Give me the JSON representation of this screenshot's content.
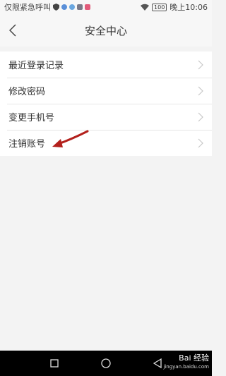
{
  "status_bar": {
    "carrier": "仅限紧急呼叫",
    "battery": "100",
    "time": "晚上10:06"
  },
  "header": {
    "title": "安全中心"
  },
  "menu": {
    "items": [
      {
        "label": "最近登录记录"
      },
      {
        "label": "修改密码"
      },
      {
        "label": "变更手机号"
      },
      {
        "label": "注销账号"
      }
    ]
  },
  "colors": {
    "annotation_arrow": "#b3201c",
    "background": "#f3f3f3",
    "nav_bar": "#000000"
  },
  "watermark": {
    "brand": "Bai 经验",
    "url": "jingyan.baidu.com"
  }
}
